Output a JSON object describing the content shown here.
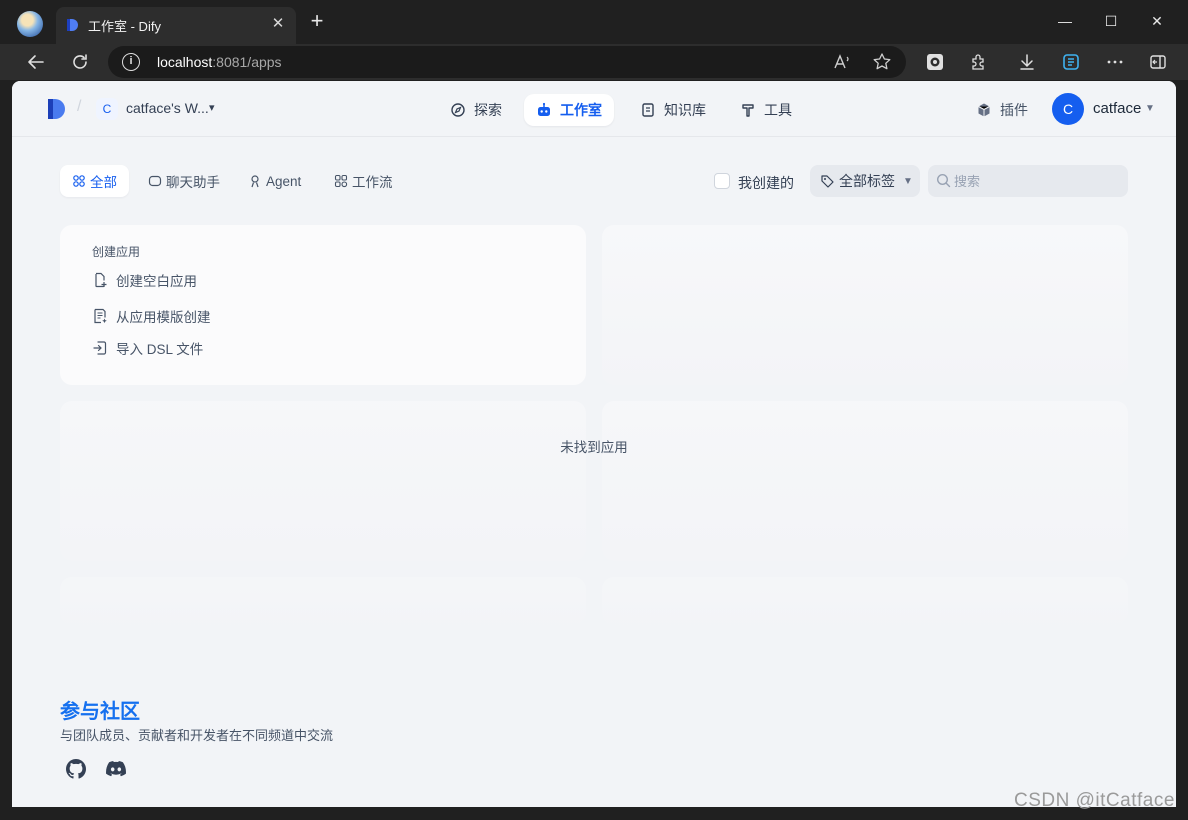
{
  "browser": {
    "tab_title": "工作室 - Dify",
    "url_host": "localhost",
    "url_path": ":8081/apps",
    "new_tab_symbol": "+",
    "close_symbol": "✕",
    "window": {
      "minimize": "—",
      "maximize": "☐",
      "close": "✕"
    }
  },
  "header": {
    "workspace_initial": "C",
    "workspace_name": "catface's W...",
    "nav": [
      {
        "label": "探索",
        "icon": "compass-icon",
        "active": false
      },
      {
        "label": "工作室",
        "icon": "robot-icon",
        "active": true
      },
      {
        "label": "知识库",
        "icon": "book-icon",
        "active": false
      },
      {
        "label": "工具",
        "icon": "hammer-icon",
        "active": false
      }
    ],
    "plugins_label": "插件",
    "user_initial": "C",
    "user_name": "catface",
    "accent": "#155eef"
  },
  "filters": {
    "tabs": [
      {
        "label": "全部",
        "active": true
      },
      {
        "label": "聊天助手",
        "active": false
      },
      {
        "label": "Agent",
        "active": false
      },
      {
        "label": "工作流",
        "active": false
      }
    ],
    "mine_label": "我创建的",
    "mine_checked": false,
    "tags_label": "全部标签",
    "search_placeholder": "搜索"
  },
  "create": {
    "title": "创建应用",
    "items": [
      {
        "label": "创建空白应用",
        "icon": "file-plus-icon"
      },
      {
        "label": "从应用模版创建",
        "icon": "template-icon"
      },
      {
        "label": "导入 DSL 文件",
        "icon": "import-icon"
      }
    ]
  },
  "empty_text": "未找到应用",
  "community": {
    "title": "参与社区",
    "description": "与团队成员、贡献者和开发者在不同频道中交流",
    "links": [
      "github-icon",
      "discord-icon"
    ]
  },
  "watermark": "CSDN @itCatface"
}
